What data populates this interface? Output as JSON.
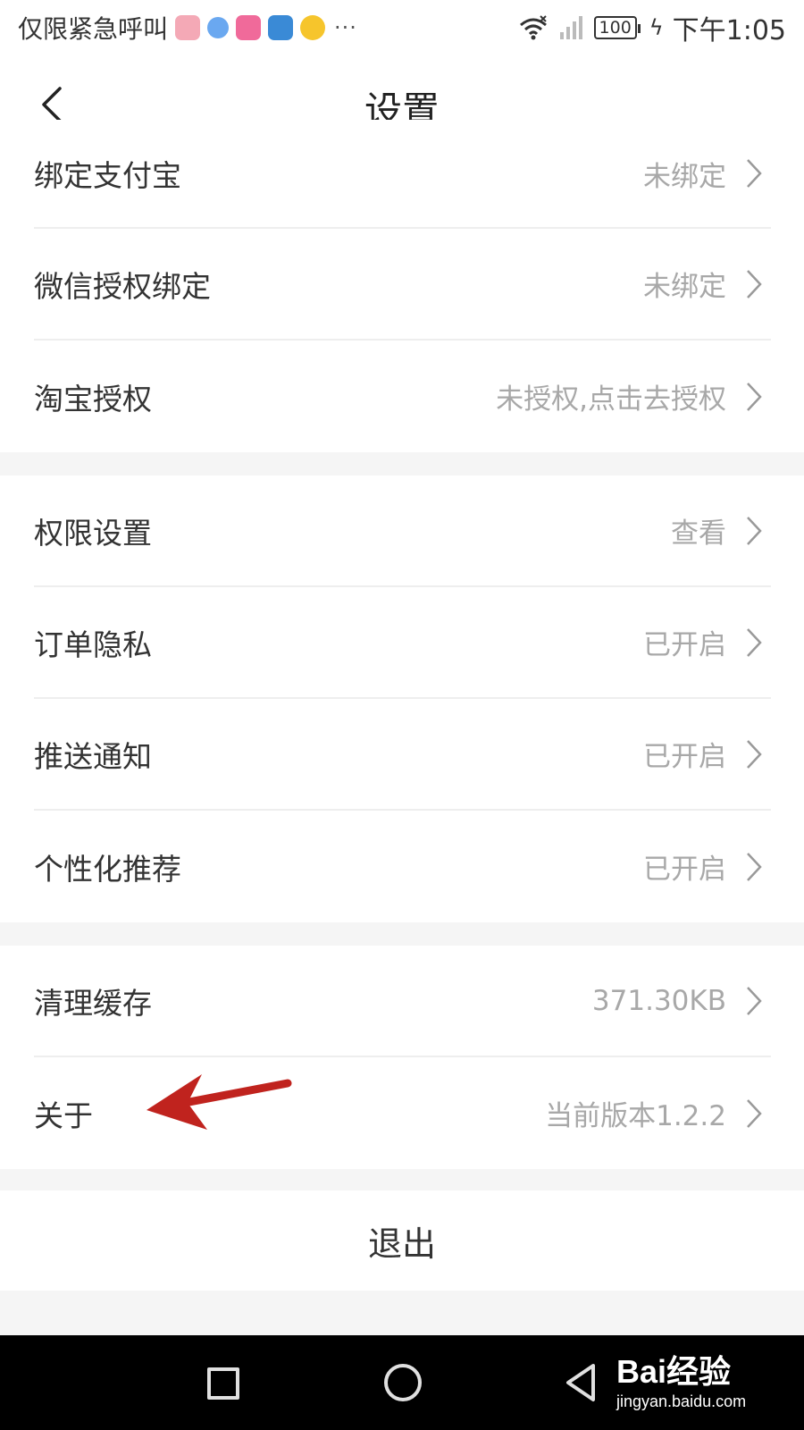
{
  "status_bar": {
    "carrier_text": "仅限紧急呼叫",
    "more": "···",
    "battery": "100",
    "time": "下午1:05",
    "app_icons": [
      "app-icon-pink",
      "app-icon-browser",
      "app-icon-magenta",
      "app-icon-blue",
      "app-icon-yellow"
    ]
  },
  "header": {
    "title": "设置"
  },
  "groups": [
    {
      "items": [
        {
          "label": "绑定支付宝",
          "value": "未绑定"
        },
        {
          "label": "微信授权绑定",
          "value": "未绑定"
        },
        {
          "label": "淘宝授权",
          "value": "未授权,点击去授权"
        }
      ]
    },
    {
      "items": [
        {
          "label": "权限设置",
          "value": "查看"
        },
        {
          "label": "订单隐私",
          "value": "已开启"
        },
        {
          "label": "推送通知",
          "value": "已开启"
        },
        {
          "label": "个性化推荐",
          "value": "已开启"
        }
      ]
    },
    {
      "items": [
        {
          "label": "清理缓存",
          "value": "371.30KB"
        },
        {
          "label": "关于",
          "value": "当前版本1.2.2"
        }
      ]
    }
  ],
  "logout": {
    "label": "退出"
  },
  "watermark": {
    "brand": "Bai经验",
    "url": "jingyan.baidu.com"
  },
  "colors": {
    "annotation_arrow": "#c0231e",
    "value_text": "#a8a8a8",
    "divider": "#eeeeee"
  }
}
